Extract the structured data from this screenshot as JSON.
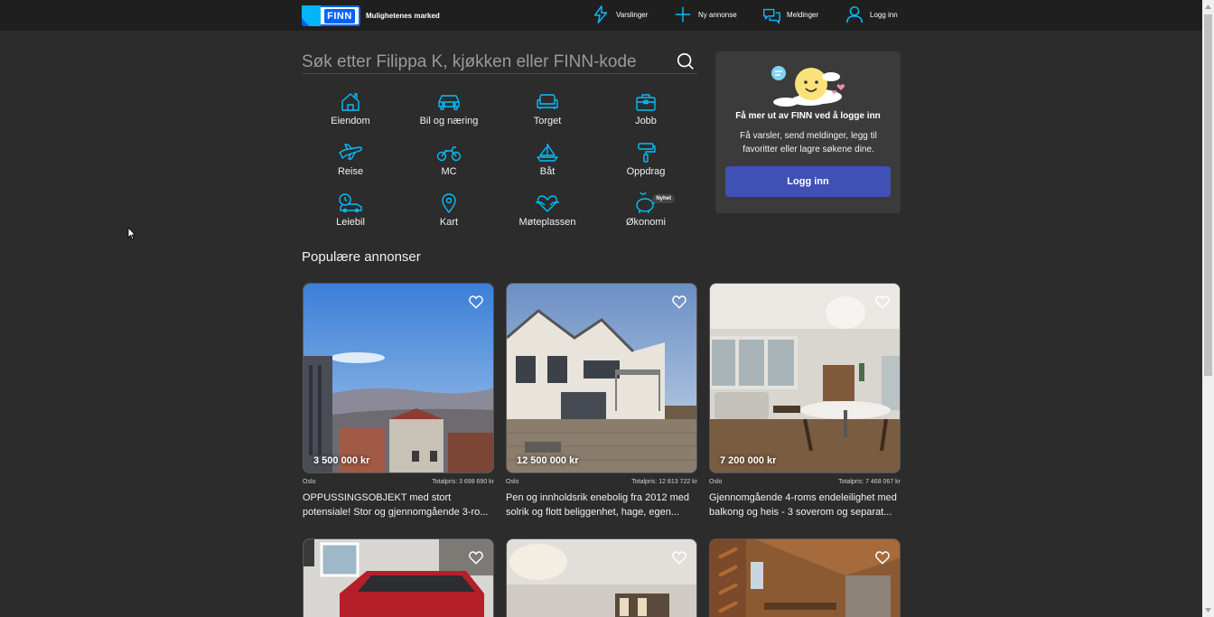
{
  "header": {
    "logo_text": "FINN",
    "tagline": "Mulighetenes marked",
    "nav": [
      {
        "label": "Varslinger",
        "icon": "lightning-icon"
      },
      {
        "label": "Ny annonse",
        "icon": "plus-icon"
      },
      {
        "label": "Meldinger",
        "icon": "chat-icon"
      },
      {
        "label": "Logg inn",
        "icon": "user-icon"
      }
    ]
  },
  "search": {
    "placeholder": "Søk etter Filippa K, kjøkken eller FINN-kode"
  },
  "categories": [
    {
      "label": "Eiendom",
      "icon": "house-icon"
    },
    {
      "label": "Bil og næring",
      "icon": "car-icon"
    },
    {
      "label": "Torget",
      "icon": "sofa-icon"
    },
    {
      "label": "Jobb",
      "icon": "briefcase-icon"
    },
    {
      "label": "Reise",
      "icon": "airplane-icon"
    },
    {
      "label": "MC",
      "icon": "motorcycle-icon"
    },
    {
      "label": "Båt",
      "icon": "sailboat-icon"
    },
    {
      "label": "Oppdrag",
      "icon": "paint-roller-icon"
    },
    {
      "label": "Leiebil",
      "icon": "rental-car-icon"
    },
    {
      "label": "Kart",
      "icon": "map-pin-icon"
    },
    {
      "label": "Møteplassen",
      "icon": "heart-handshake-icon"
    },
    {
      "label": "Økonomi",
      "icon": "piggy-bank-icon",
      "badge": "Nyhet"
    }
  ],
  "login_card": {
    "title": "Få mer ut av FINN ved å logge inn",
    "text": "Få varsler, send meldinger, legg til favoritter eller lagre søkene dine.",
    "button": "Logg inn"
  },
  "section_title": "Populære annonser",
  "ads": [
    {
      "price": "3 500 000 kr",
      "location": "Oslo",
      "total": "Totalpris: 3 698 690 kr",
      "title": "OPPUSSINGSOBJEKT med stort potensiale! Stor og gjennomgående 3-ro..."
    },
    {
      "price": "12 500 000 kr",
      "location": "Oslo",
      "total": "Totalpris: 12 813 722 kr",
      "title": "Pen og innholdsrik enebolig fra 2012 med solrik og flott beliggenhet, hage, egen..."
    },
    {
      "price": "7 200 000 kr",
      "location": "Oslo",
      "total": "Totalpris: 7 468 067 kr",
      "title": "Gjennomgående 4-roms endeleilighet med balkong og heis - 3 soverom og separat..."
    }
  ],
  "colors": {
    "background": "#2c2c2c",
    "header": "#1f1f1f",
    "accent_icon": "#06befb",
    "login_button": "#3f51b5",
    "brand_blue": "#0063fb"
  }
}
